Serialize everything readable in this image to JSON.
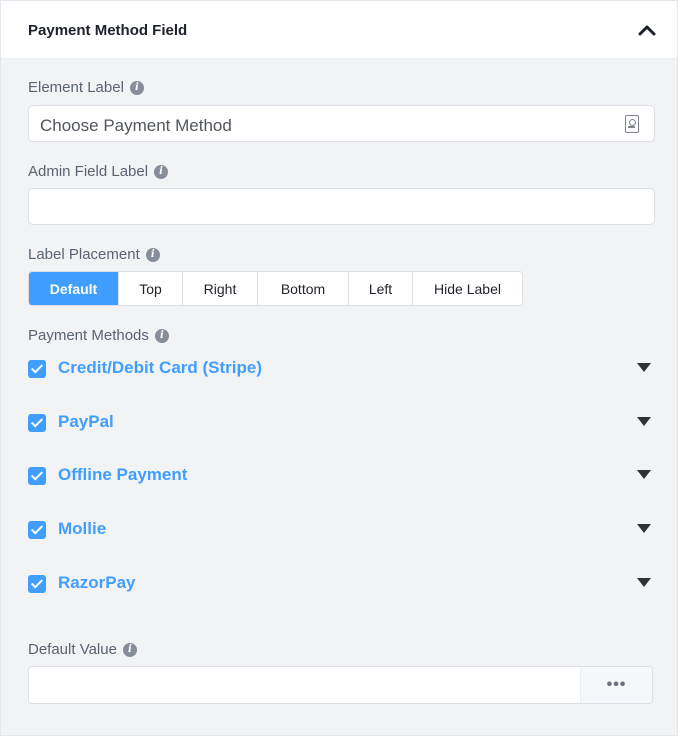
{
  "header": {
    "title": "Payment Method Field",
    "collapse_icon": "chevron-up-icon"
  },
  "element_label": {
    "label": "Element Label",
    "value": "Choose Payment Method",
    "shortcode_icon": "shortcode-icon"
  },
  "admin_field_label": {
    "label": "Admin Field Label",
    "value": ""
  },
  "label_placement": {
    "label": "Label Placement",
    "options": [
      "Default",
      "Top",
      "Right",
      "Bottom",
      "Left",
      "Hide Label"
    ],
    "selected": "Default"
  },
  "payment_methods": {
    "label": "Payment Methods",
    "items": [
      {
        "label": "Credit/Debit Card (Stripe)",
        "checked": true
      },
      {
        "label": "PayPal",
        "checked": true
      },
      {
        "label": "Offline Payment",
        "checked": true
      },
      {
        "label": "Mollie",
        "checked": true
      },
      {
        "label": "RazorPay",
        "checked": true
      }
    ]
  },
  "default_value": {
    "label": "Default Value",
    "value": "",
    "button_label": "•••"
  },
  "colors": {
    "accent": "#409eff",
    "panel_bg": "#f2f3f5",
    "text": "#5b6270"
  }
}
